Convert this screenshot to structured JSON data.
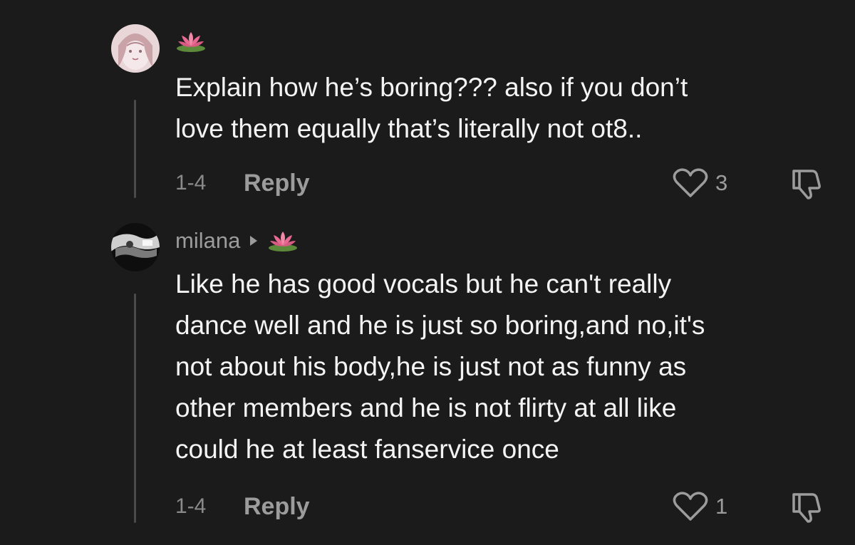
{
  "comments": [
    {
      "username": "",
      "badge_icon": "lotus-icon",
      "text": "Explain how he’s boring??? also if you don’t\nlove them equally that’s literally not ot8..",
      "date": "1-4",
      "reply_label": "Reply",
      "like_count": "3"
    },
    {
      "username": "milana",
      "badge_icon": "lotus-icon",
      "text": "Like he has good vocals but he can't really\ndance well and he is just so boring,and no,it's\nnot about his body,he is just not as funny as\nother members and he is not flirty at all like\ncould he at least fanservice once",
      "date": "1-4",
      "reply_label": "Reply",
      "like_count": "1"
    }
  ],
  "colors": {
    "background": "#1b1b1b",
    "text": "#f4f4f4",
    "muted": "#9c9c9c",
    "thread_line": "#4a4a4a"
  }
}
